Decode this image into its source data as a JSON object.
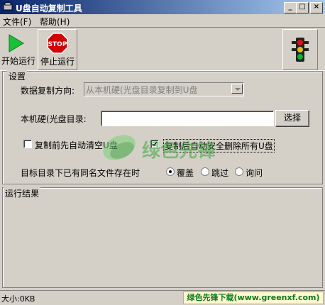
{
  "window": {
    "title": "U盘自动复制工具"
  },
  "menu": [
    {
      "label": "文件(F)"
    },
    {
      "label": "帮助(H)"
    }
  ],
  "toolbar": {
    "start_label": "开始运行",
    "stop_label": "停止运行",
    "stop_sign_text": "STOP"
  },
  "settings": {
    "group_title": "设置",
    "direction_label": "数据复制方向:",
    "direction_value": "从本机硬(光盘目录复制到U盘",
    "dir_label": "本机硬(光盘目录:",
    "dir_value": "",
    "browse_label": "选择",
    "clear_label": "复制前先自动清空U盘",
    "clear_checked": false,
    "safe_delete_label": "复制后自动安全删除所有U盘",
    "safe_delete_checked": true,
    "conflict_label": "目标目录下已有同名文件存在时",
    "options": [
      {
        "label": "覆盖",
        "selected": true
      },
      {
        "label": "跳过",
        "selected": false
      },
      {
        "label": "询问",
        "selected": false
      }
    ]
  },
  "results": {
    "group_title": "运行结果"
  },
  "status": {
    "size_text": "大小:0KB",
    "banner_text": "绿色先锋下载(www.greenxf.com)"
  },
  "watermark": {
    "text": "绿色先锋"
  },
  "colors": {
    "titlebar_start": "#0a246a",
    "titlebar_end": "#a6caf0",
    "start_green": "#19c13a",
    "stop_red": "#d40000",
    "watermark_green": "#3aa53a"
  }
}
